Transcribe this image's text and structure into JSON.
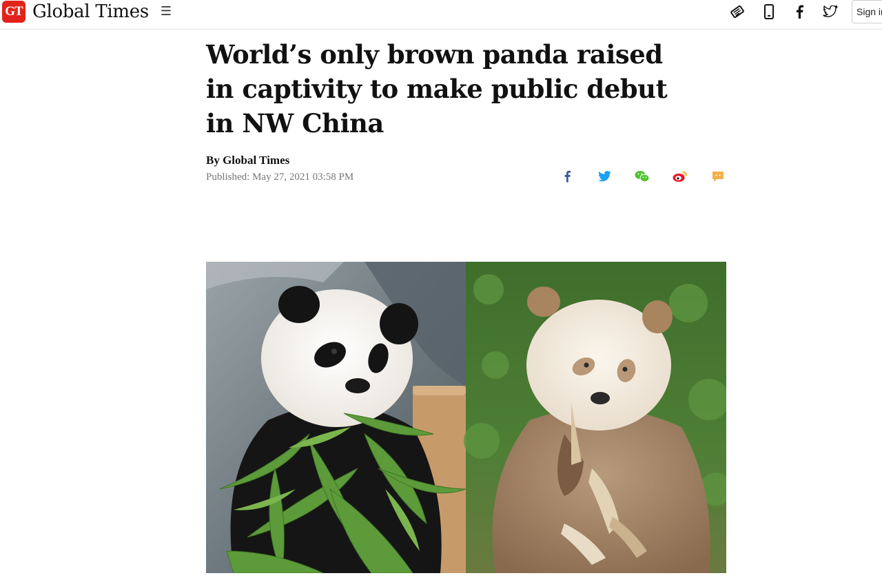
{
  "header": {
    "logo_badge": "GT",
    "logo_text": "Global Times",
    "menu_icon": "☰",
    "icons": [
      "newspaper-icon",
      "mobile-icon",
      "facebook-icon",
      "twitter-icon"
    ],
    "signin_label": "Sign in",
    "brand_color": "#e2231a"
  },
  "article": {
    "headline": "World’s only brown panda raised in captivity to make public debut in NW China",
    "byline": "By Global Times",
    "published": "Published: May 27, 2021 03:58 PM",
    "share_icons": [
      "facebook-icon",
      "twitter-icon",
      "wechat-icon",
      "weibo-icon",
      "comment-icon"
    ],
    "share_colors": {
      "facebook": "#3b5998",
      "twitter": "#1da1f2",
      "wechat": "#51c332",
      "weibo": "#e6162d",
      "comment": "#f5a623"
    }
  },
  "hero_image": {
    "description_icon": "panda-photo"
  }
}
